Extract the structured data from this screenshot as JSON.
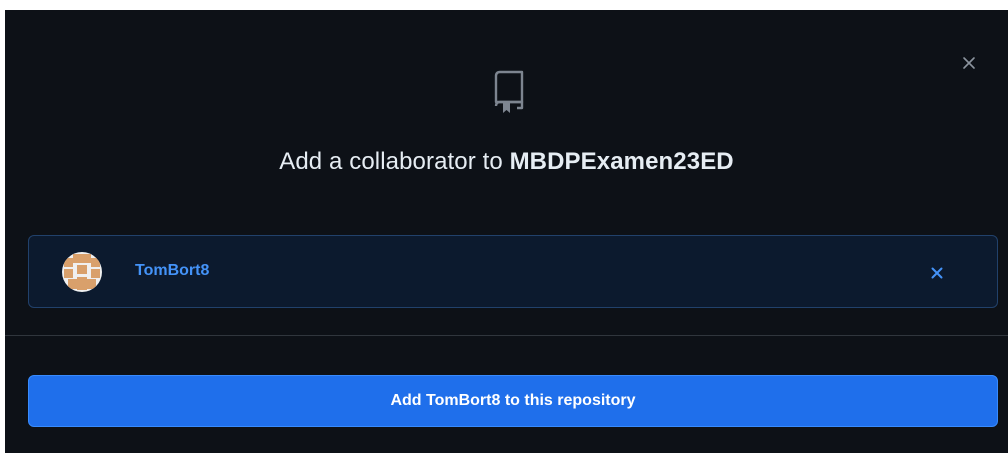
{
  "dialog": {
    "title_prefix": "Add a collaborator to",
    "repo_name": "MBDPExamen23ED",
    "close_icon": "close-icon",
    "repo_icon": "repo-icon"
  },
  "selected_user": {
    "username": "TomBort8",
    "avatar_icon": "identicon-avatar",
    "remove_icon": "close-icon"
  },
  "actions": {
    "add_label": "Add TomBort8 to this repository"
  },
  "colors": {
    "background": "#0d1117",
    "accent": "#4493f8",
    "primary_button": "#1f6feb",
    "text": "#e6edf3"
  }
}
